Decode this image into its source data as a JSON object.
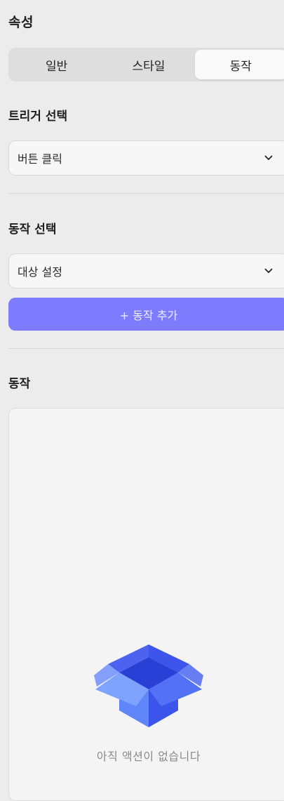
{
  "panel": {
    "title": "속성"
  },
  "tabs": [
    {
      "label": "일반",
      "active": false
    },
    {
      "label": "스타일",
      "active": false
    },
    {
      "label": "동작",
      "active": true
    }
  ],
  "trigger": {
    "label": "트리거 선택",
    "value": "버튼 클릭"
  },
  "action_select": {
    "label": "동작 선택",
    "value": "대상 설정"
  },
  "add_button": {
    "label": "+ 동작 추가",
    "color": "#7d7cff"
  },
  "actions": {
    "label": "동작",
    "empty_text": "아직 액션이 없습니다",
    "empty_icon": "open-box-icon"
  }
}
